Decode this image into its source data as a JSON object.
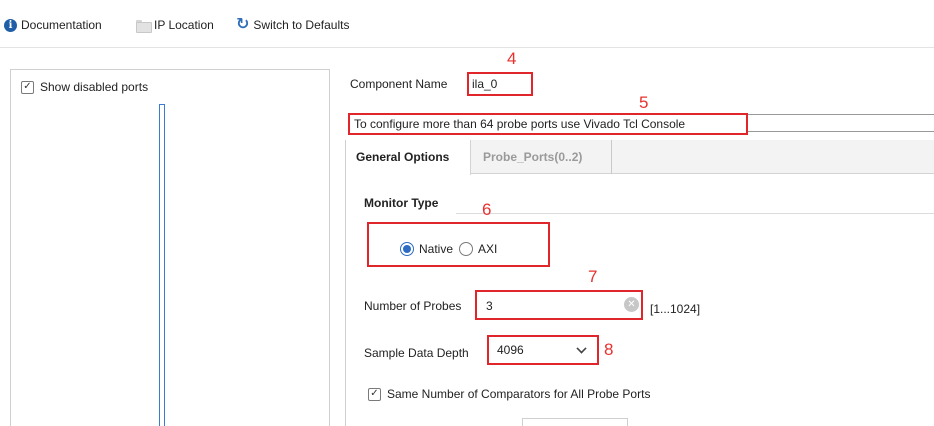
{
  "toolbar": {
    "documentation_label": "Documentation",
    "documentation_icon": "info-icon",
    "ip_location_label": "IP Location",
    "ip_location_icon": "folder-icon",
    "switch_defaults_label": "Switch to Defaults",
    "switch_defaults_icon": "refresh-icon"
  },
  "left_panel": {
    "show_disabled_ports_label": "Show disabled ports",
    "show_disabled_ports_checked": true
  },
  "component": {
    "label": "Component Name",
    "value": "ila_0"
  },
  "info_message": "To configure more than 64 probe ports use Vivado Tcl Console",
  "tabs": [
    {
      "label": "General Options",
      "active": true
    },
    {
      "label": "Probe_Ports(0..2)",
      "active": false
    }
  ],
  "monitor_type": {
    "title": "Monitor Type",
    "options": [
      {
        "label": "Native",
        "selected": true
      },
      {
        "label": "AXI",
        "selected": false
      }
    ]
  },
  "number_of_probes": {
    "label": "Number of Probes",
    "value": "3",
    "range": "[1...1024]"
  },
  "sample_data_depth": {
    "label": "Sample Data Depth",
    "value": "4096"
  },
  "same_comparators": {
    "label": "Same Number of Comparators for All Probe Ports",
    "checked": true
  },
  "annotations": {
    "n4": "4",
    "n5": "5",
    "n6": "6",
    "n7": "7",
    "n8": "8"
  },
  "colors": {
    "annotation_red": "#e0262b",
    "accent_blue": "#2d6bc4"
  }
}
